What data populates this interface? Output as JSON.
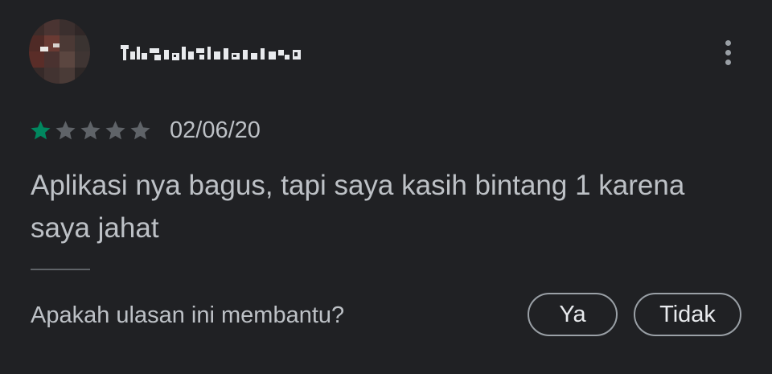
{
  "review": {
    "author_name": "Tulus Nikahan",
    "rating": 1,
    "rating_max": 5,
    "date": "02/06/20",
    "text": "Aplikasi nya bagus, tapi saya kasih bintang 1 karena saya jahat"
  },
  "helpful": {
    "question": "Apakah ulasan ini membantu?",
    "yes_label": "Ya",
    "no_label": "Tidak"
  },
  "icons": {
    "menu": "more-vert-icon",
    "star": "star-icon"
  },
  "colors": {
    "background": "#202124",
    "text": "#bdc1c6",
    "star_filled": "#01875f",
    "star_empty": "#5f6368",
    "button_border": "#9aa0a6"
  }
}
